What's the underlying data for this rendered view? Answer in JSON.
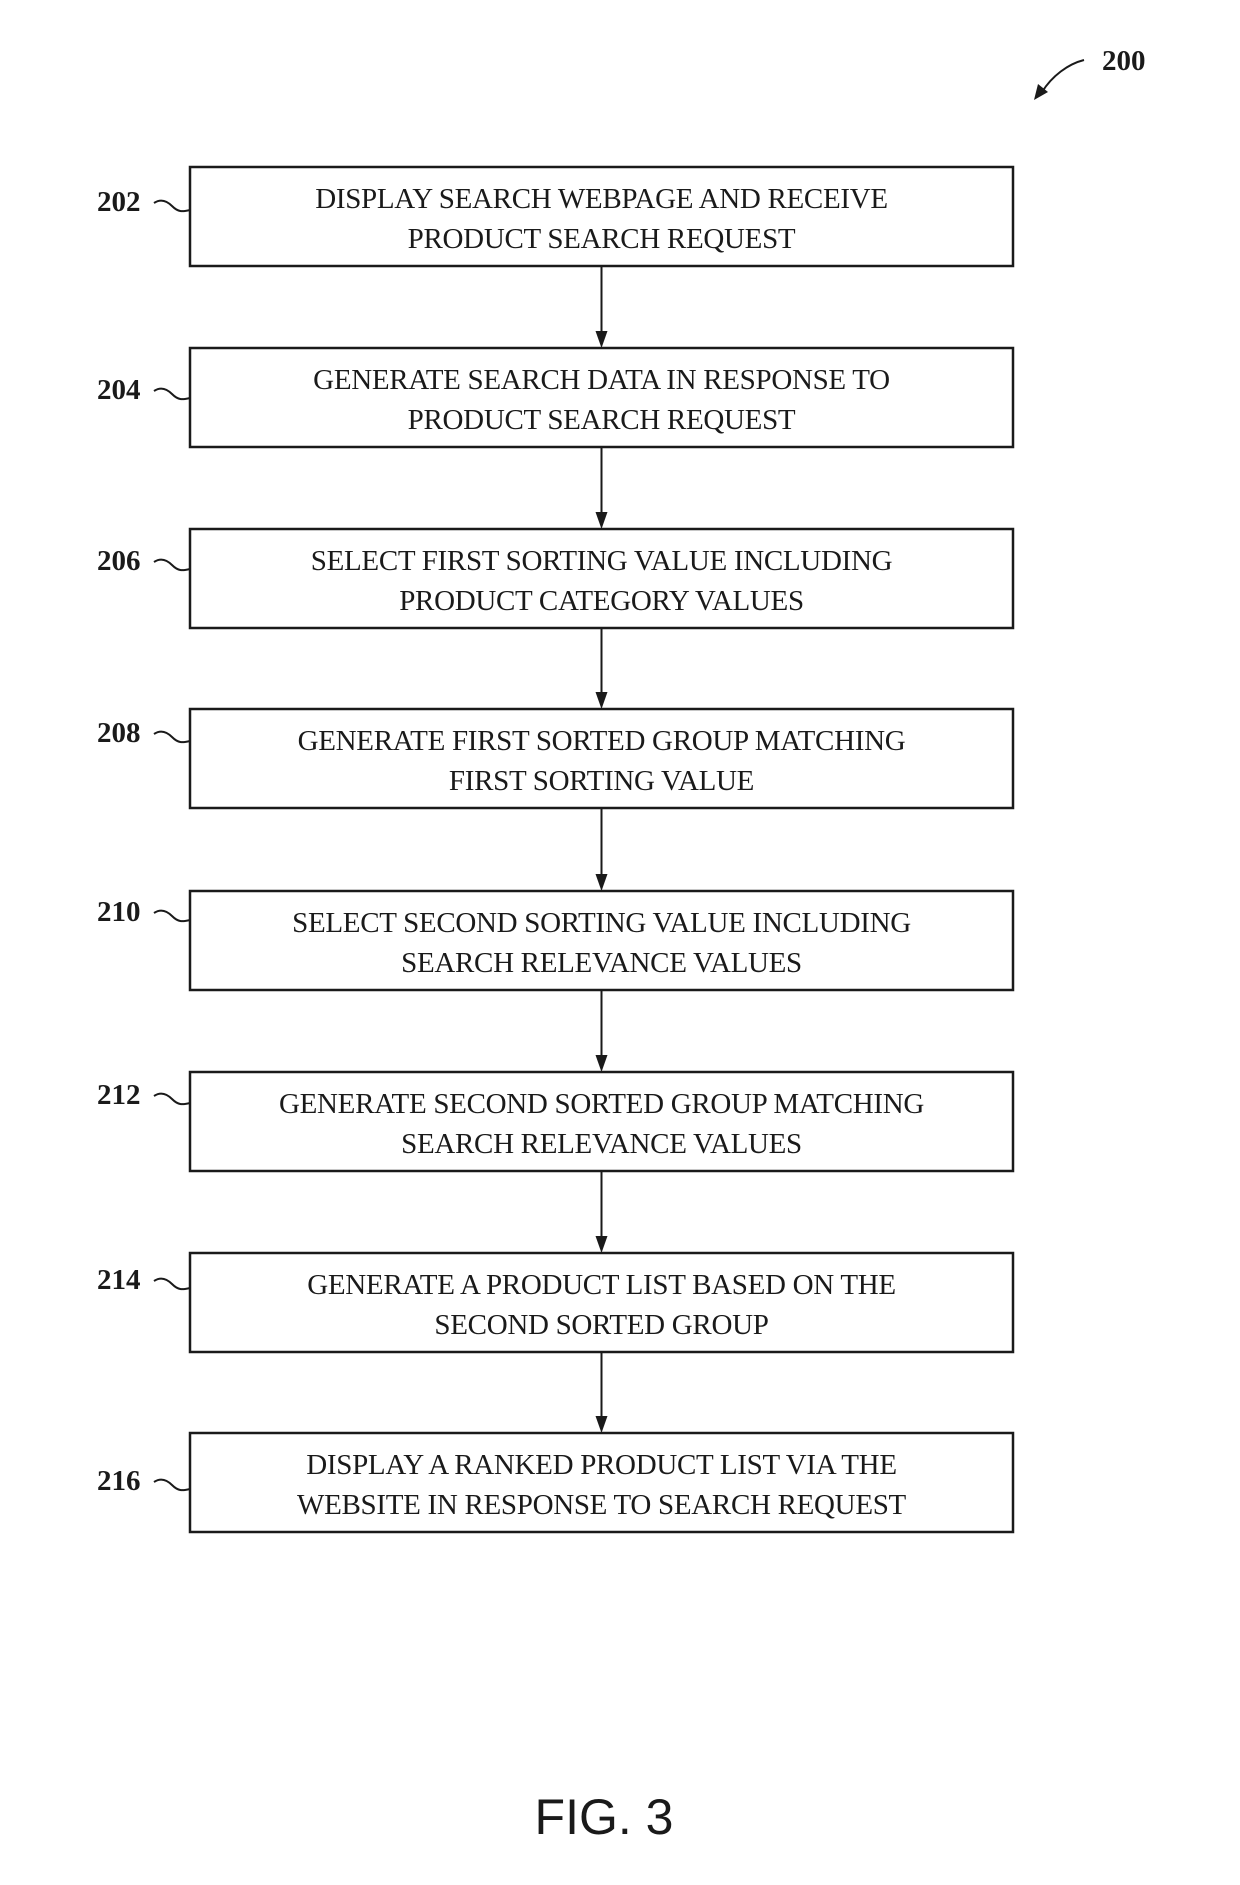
{
  "figure": {
    "reference_number": "200",
    "caption": "FIG. 3"
  },
  "steps": [
    {
      "ref": "202",
      "lines": [
        "DISPLAY SEARCH WEBPAGE AND RECEIVE",
        "PRODUCT SEARCH REQUEST"
      ]
    },
    {
      "ref": "204",
      "lines": [
        "GENERATE SEARCH DATA IN RESPONSE TO",
        "PRODUCT SEARCH REQUEST"
      ]
    },
    {
      "ref": "206",
      "lines": [
        "SELECT FIRST SORTING VALUE INCLUDING",
        "PRODUCT CATEGORY VALUES"
      ]
    },
    {
      "ref": "208",
      "lines": [
        "GENERATE FIRST SORTED GROUP MATCHING",
        "FIRST SORTING VALUE"
      ]
    },
    {
      "ref": "210",
      "lines": [
        "SELECT SECOND SORTING VALUE INCLUDING",
        "SEARCH RELEVANCE VALUES"
      ]
    },
    {
      "ref": "212",
      "lines": [
        "GENERATE SECOND SORTED GROUP MATCHING",
        "SEARCH RELEVANCE VALUES"
      ]
    },
    {
      "ref": "214",
      "lines": [
        "GENERATE A PRODUCT LIST BASED ON THE",
        "SECOND SORTED GROUP"
      ]
    },
    {
      "ref": "216",
      "lines": [
        "DISPLAY A RANKED PRODUCT LIST VIA THE",
        "WEBSITE IN RESPONSE TO SEARCH REQUEST"
      ]
    }
  ],
  "flow": [
    {
      "from": "202",
      "to": "204"
    },
    {
      "from": "204",
      "to": "206"
    },
    {
      "from": "206",
      "to": "208"
    },
    {
      "from": "208",
      "to": "210"
    },
    {
      "from": "210",
      "to": "212"
    },
    {
      "from": "212",
      "to": "214"
    },
    {
      "from": "214",
      "to": "216"
    }
  ]
}
